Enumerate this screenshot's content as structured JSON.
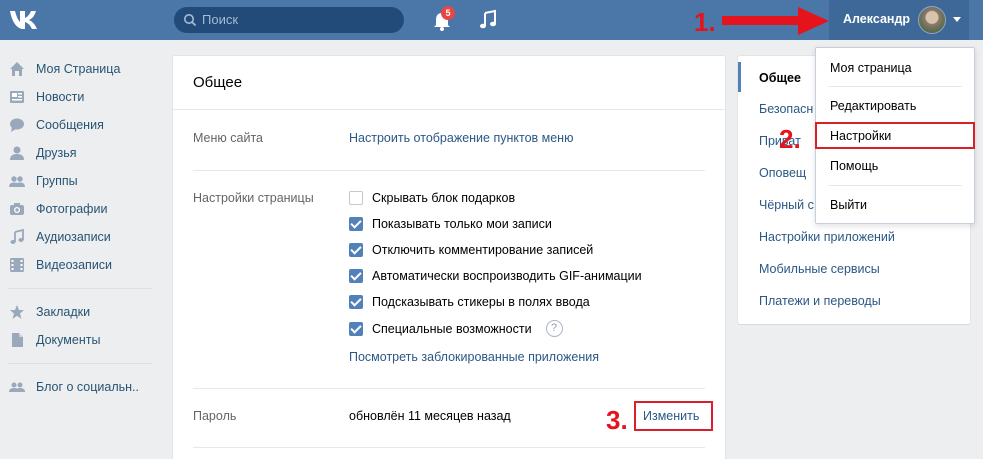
{
  "header": {
    "search_placeholder": "Поиск",
    "notification_count": "5",
    "profile_name": "Александр"
  },
  "leftnav": {
    "items": [
      {
        "label": "Моя Страница",
        "icon": "home-icon"
      },
      {
        "label": "Новости",
        "icon": "news-icon"
      },
      {
        "label": "Сообщения",
        "icon": "message-icon"
      },
      {
        "label": "Друзья",
        "icon": "user-icon"
      },
      {
        "label": "Группы",
        "icon": "group-icon"
      },
      {
        "label": "Фотографии",
        "icon": "camera-icon"
      },
      {
        "label": "Аудиозаписи",
        "icon": "music-icon"
      },
      {
        "label": "Видеозаписи",
        "icon": "video-icon"
      },
      {
        "label": "Закладки",
        "icon": "star-icon"
      },
      {
        "label": "Документы",
        "icon": "document-icon"
      },
      {
        "label": "Блог о социальн..",
        "icon": "community-icon"
      }
    ]
  },
  "main": {
    "title": "Общее",
    "menu_label": "Меню сайта",
    "menu_link": "Настроить отображение пунктов меню",
    "page_settings_label": "Настройки страницы",
    "checkboxes": [
      {
        "label": "Скрывать блок подарков",
        "checked": false
      },
      {
        "label": "Показывать только мои записи",
        "checked": true
      },
      {
        "label": "Отключить комментирование записей",
        "checked": true
      },
      {
        "label": "Автоматически воспроизводить GIF-анимации",
        "checked": true
      },
      {
        "label": "Подсказывать стикеры в полях ввода",
        "checked": true
      },
      {
        "label": "Специальные возможности",
        "checked": true
      }
    ],
    "help_glyph": "?",
    "blocked_apps_link": "Посмотреть заблокированные приложения",
    "password_label": "Пароль",
    "password_status": "обновлён 11 месяцев назад",
    "password_change": "Изменить"
  },
  "rightmenu": {
    "items": [
      "Общее",
      "Безопасн",
      "Приват",
      "Оповещ",
      "Чёрный с",
      "Настройки приложений",
      "Мобильные сервисы",
      "Платежи и переводы"
    ]
  },
  "dropdown": {
    "items": [
      "Моя страница",
      "Редактировать",
      "Настройки",
      "Помощь",
      "Выйти"
    ]
  },
  "annotations": {
    "step1": "1.",
    "step2": "2.",
    "step3": "3."
  },
  "colors": {
    "header": "#4a76a8",
    "link": "#2a5885",
    "accent": "#5181b8",
    "annotation_red": "#e5131b"
  }
}
